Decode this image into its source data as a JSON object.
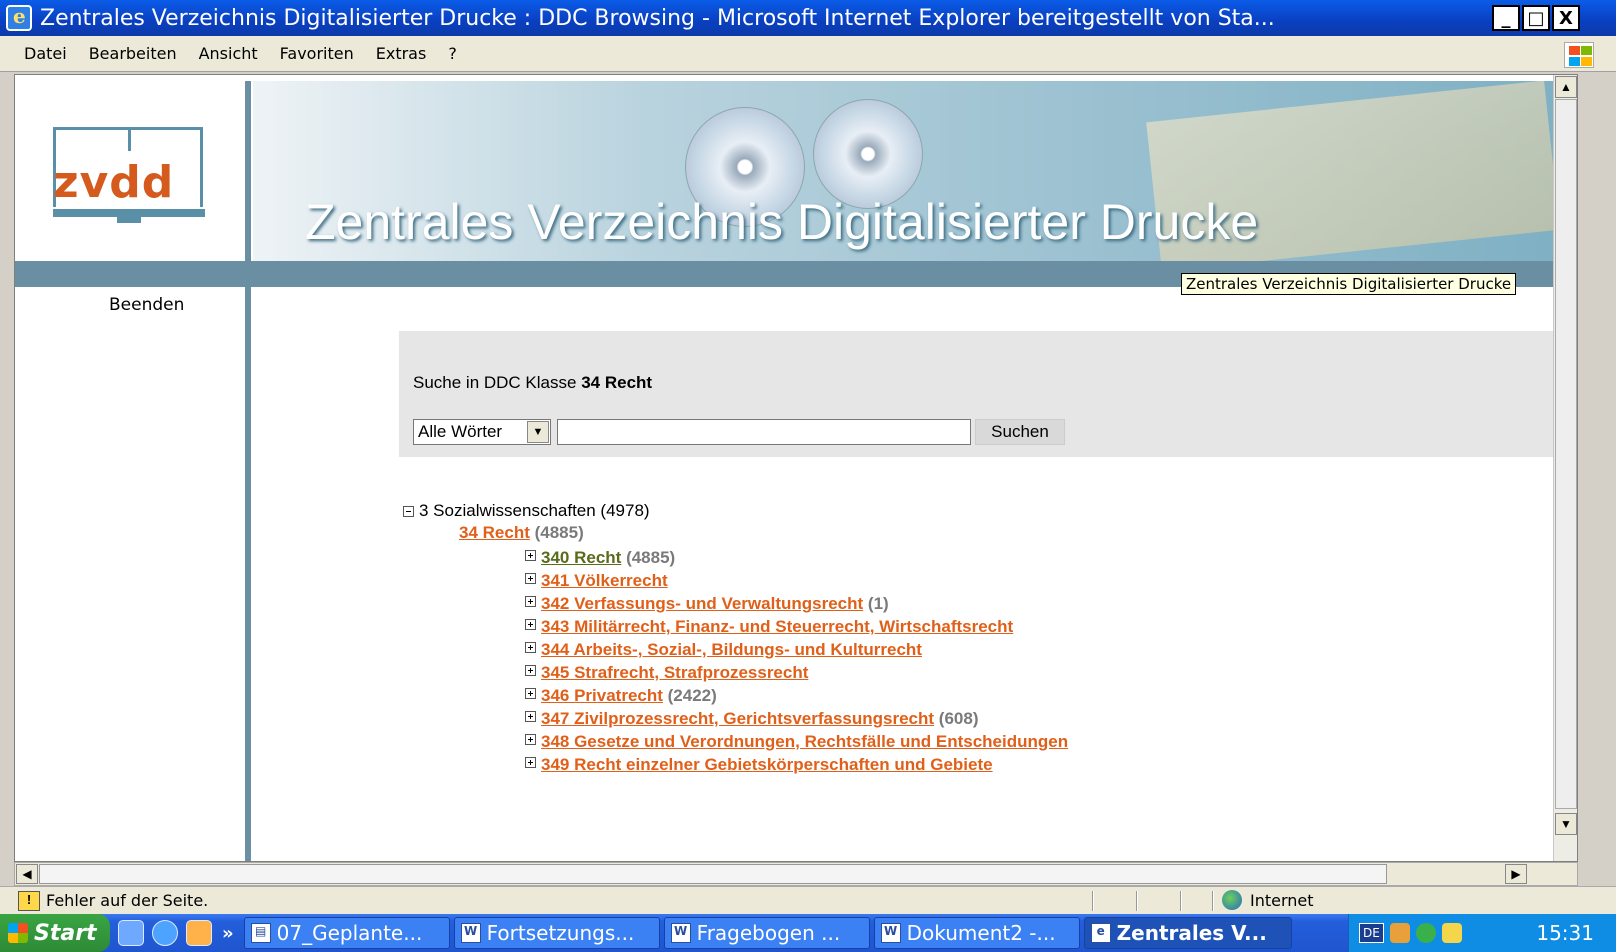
{
  "window": {
    "title": "Zentrales Verzeichnis Digitalisierter Drucke : DDC Browsing - Microsoft Internet Explorer bereitgestellt von Sta...",
    "minimize": "_",
    "maximize": "□",
    "close": "X"
  },
  "menu": [
    "Datei",
    "Bearbeiten",
    "Ansicht",
    "Favoriten",
    "Extras",
    "?"
  ],
  "site": {
    "logo": "zvdd",
    "banner_title": "Zentrales Verzeichnis Digitalisierter Drucke",
    "tooltip": "Zentrales Verzeichnis Digitalisierter Drucke",
    "exit_link": "Beenden"
  },
  "search": {
    "heading_prefix": "Suche in DDC Klasse",
    "heading_class": "34 Recht",
    "mode_selected": "Alle Wörter",
    "query": "",
    "button": "Suchen"
  },
  "tree": {
    "root": "3 Sozialwissenschaften (4978)",
    "level2": {
      "label": "34 Recht",
      "count": "(4885)"
    },
    "items": [
      {
        "label": "340 Recht",
        "count": "(4885)"
      },
      {
        "label": "341 Völkerrecht",
        "count": ""
      },
      {
        "label": "342 Verfassungs- und Verwaltungsrecht",
        "count": "(1)"
      },
      {
        "label": "343 Militärrecht, Finanz- und Steuerrecht, Wirtschaftsrecht",
        "count": ""
      },
      {
        "label": "344 Arbeits-, Sozial-, Bildungs- und Kulturrecht",
        "count": ""
      },
      {
        "label": "345 Strafrecht, Strafprozessrecht",
        "count": ""
      },
      {
        "label": "346 Privatrecht",
        "count": "(2422)"
      },
      {
        "label": "347 Zivilprozessrecht, Gerichtsverfassungsrecht",
        "count": "(608)"
      },
      {
        "label": "348 Gesetze und Verordnungen, Rechtsfälle und Entscheidungen",
        "count": ""
      },
      {
        "label": "349 Recht einzelner Gebietskörperschaften und Gebiete",
        "count": ""
      }
    ]
  },
  "status": {
    "message": "Fehler auf der Seite.",
    "zone": "Internet"
  },
  "taskbar": {
    "start": "Start",
    "chevron": "»",
    "tasks": [
      "07_Geplante...",
      "Fortsetzungs...",
      "Fragebogen ...",
      "Dokument2 -...",
      "Zentrales V..."
    ],
    "lang": "DE",
    "clock": "15:31"
  },
  "colors": {
    "link": "#e0601a",
    "visited_link": "#5a6b1a",
    "accent_band": "#6a8fa3",
    "logo_orange": "#d45a1e"
  }
}
